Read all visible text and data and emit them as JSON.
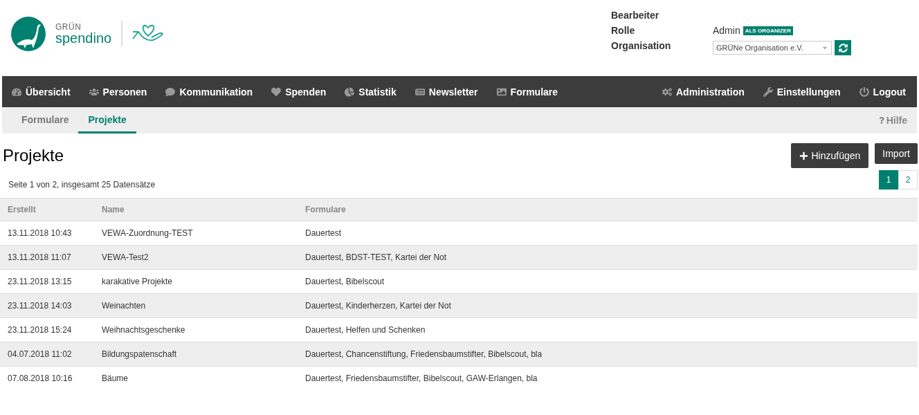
{
  "logo": {
    "brand_top": "GRÜN",
    "brand_name": "spendino"
  },
  "user_info": {
    "rows": [
      {
        "label": "Bearbeiter"
      },
      {
        "label": "Rolle",
        "value": "Admin",
        "badge": "ALS ORGANIZER"
      },
      {
        "label": "Organisation"
      }
    ],
    "organisation_select": {
      "value": "GRÜNe Organisation e.V."
    }
  },
  "main_nav": {
    "left": [
      {
        "label": "Übersicht"
      },
      {
        "label": "Personen"
      },
      {
        "label": "Kommunikation"
      },
      {
        "label": "Spenden"
      },
      {
        "label": "Statistik"
      },
      {
        "label": "Newsletter"
      },
      {
        "label": "Formulare"
      }
    ],
    "right": [
      {
        "label": "Administration"
      },
      {
        "label": "Einstellungen"
      },
      {
        "label": "Logout"
      }
    ]
  },
  "sub_nav": {
    "tabs": [
      {
        "label": "Formulare",
        "selected": false
      },
      {
        "label": "Projekte",
        "selected": true
      }
    ],
    "help": "Hilfe"
  },
  "page_title": "Projekte",
  "buttons": [
    {
      "label": "Hinzufügen",
      "kind": "add"
    },
    {
      "label": "Import",
      "kind": "plain"
    }
  ],
  "pagination": {
    "pages": [
      {
        "label": "1",
        "selected": true
      },
      {
        "label": "2",
        "selected": false
      }
    ]
  },
  "record_info": "Seite 1 von 2, insgesamt 25 Datensätze",
  "table": {
    "columns": [
      "Erstellt",
      "Name",
      "Formulare"
    ],
    "rows": [
      [
        "13.11.2018 10:43",
        "VEWA-Zuordnung-TEST",
        "Dauertest"
      ],
      [
        "13.11.2018 11:07",
        "VEWA-Test2",
        "Dauertest, BDST-TEST, Kartei der Not"
      ],
      [
        "23.11.2018 13:15",
        "karakative Projekte",
        "Dauertest, Bibelscout"
      ],
      [
        "23.11.2018 14:03",
        "Weinachten",
        "Dauertest, Kinderherzen, Kartei der Not"
      ],
      [
        "23.11.2018 15:24",
        "Weihnachtsgeschenke",
        "Dauertest, Helfen und Schenken"
      ],
      [
        "04.07.2018 11:02",
        "Bildungspatenschaft",
        "Dauertest, Chancenstiftung, Friedensbaumstifter, Bibelscout, bla"
      ],
      [
        "07.08.2018 10:16",
        "Bäume",
        "Dauertest, Friedensbaumstifter, Bibelscout, GAW-Erlangen, bla"
      ]
    ]
  }
}
